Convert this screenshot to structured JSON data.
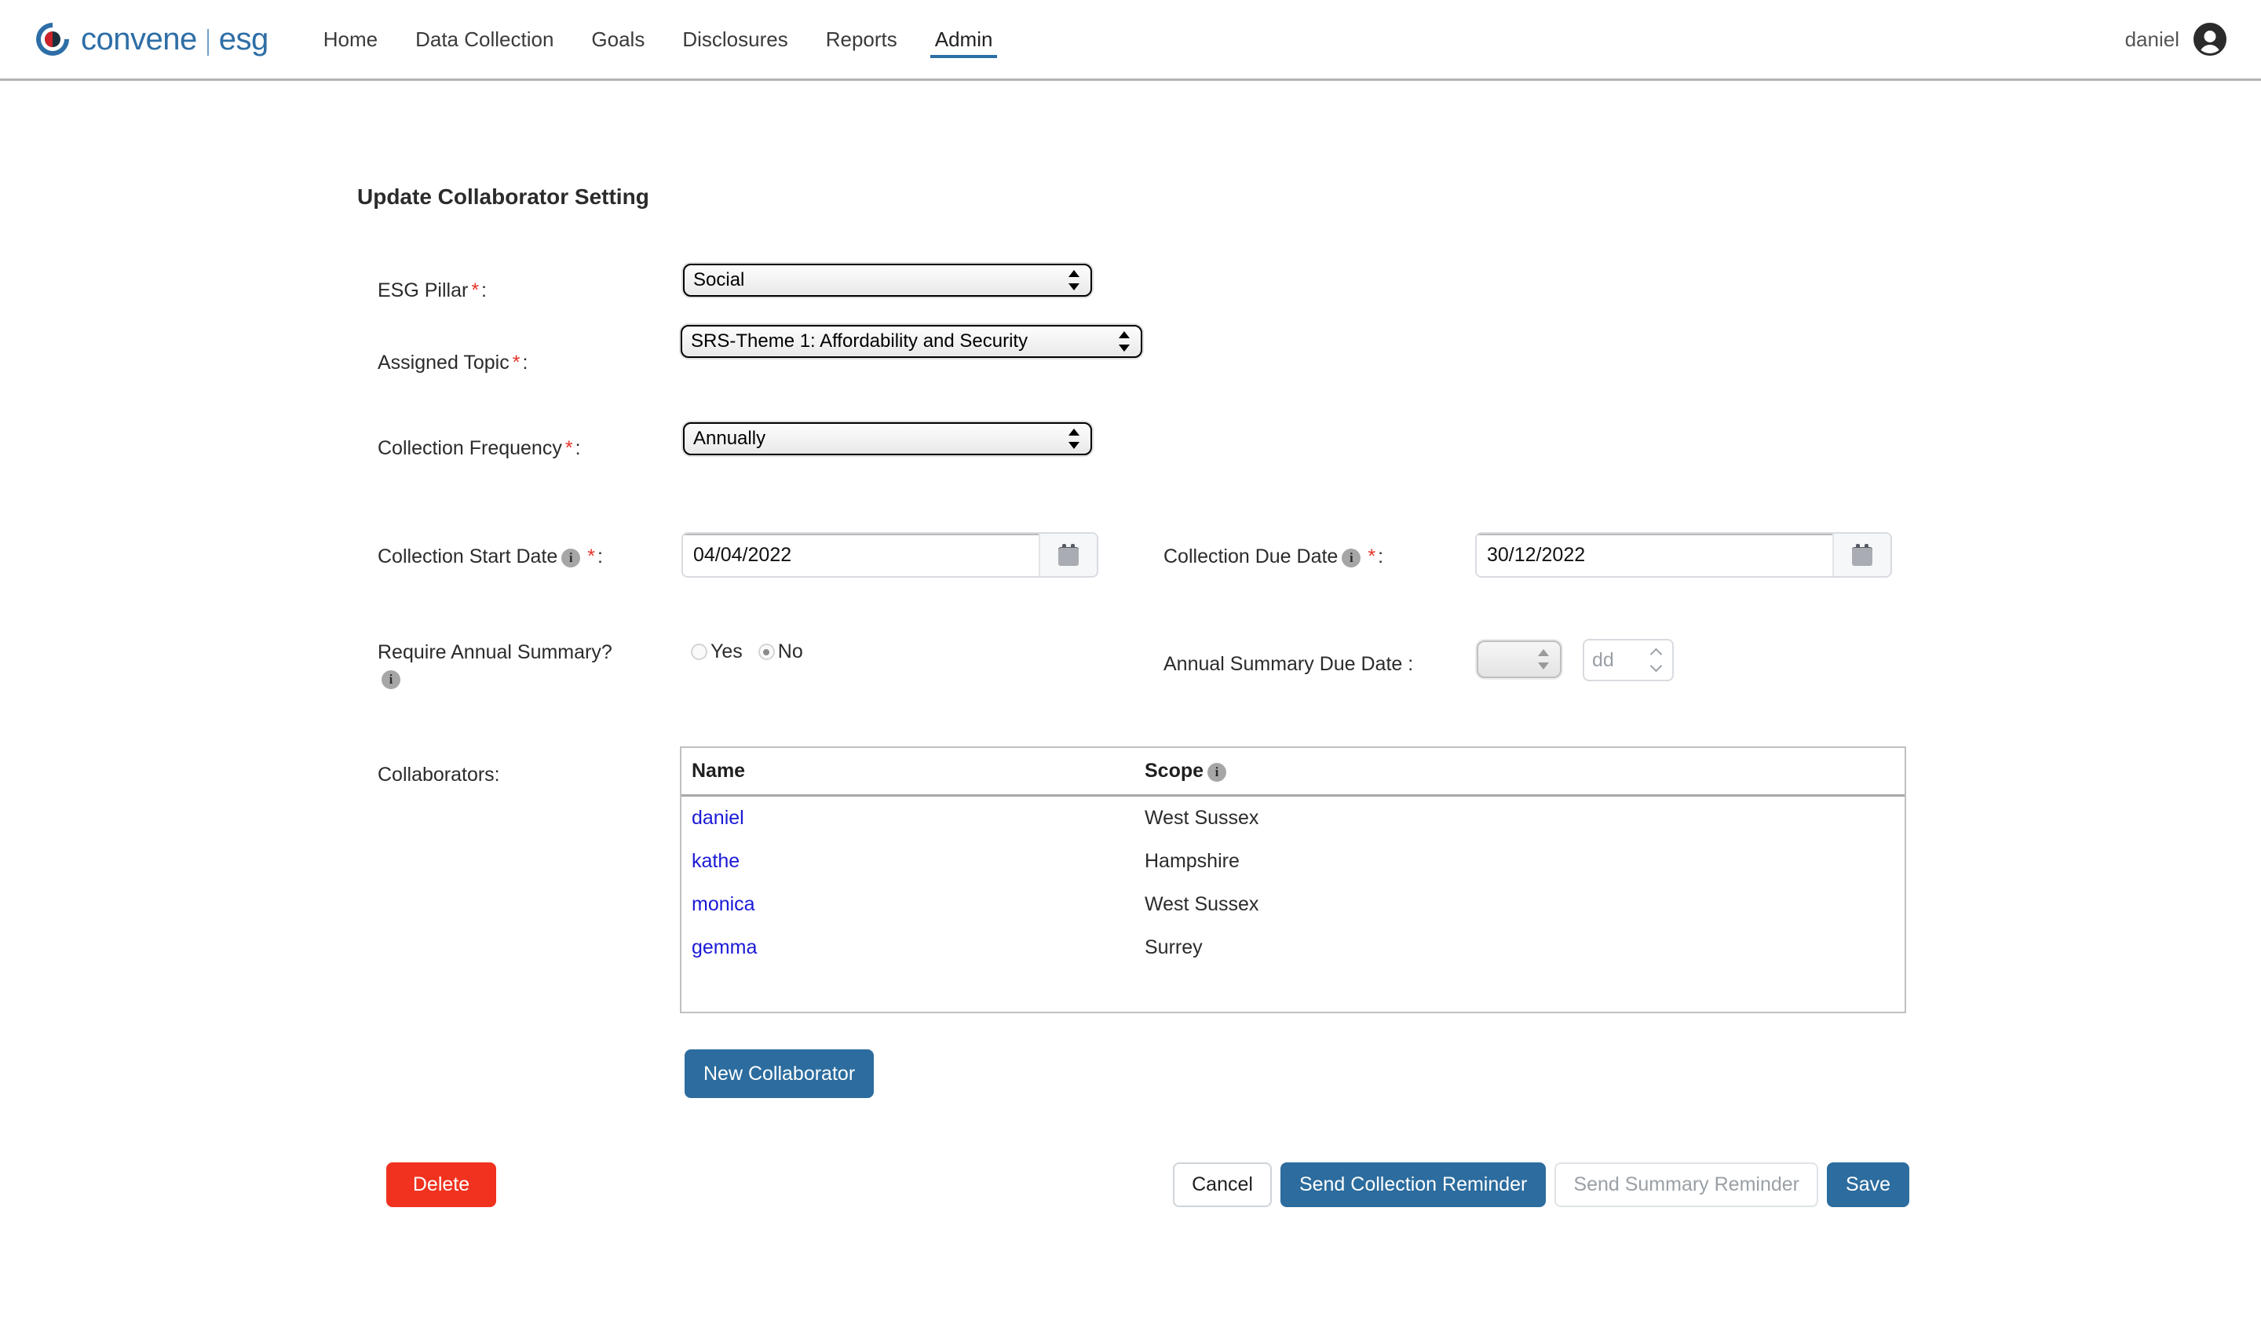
{
  "brand": {
    "name": "convene",
    "sub": "esg"
  },
  "nav": {
    "items": [
      {
        "label": "Home",
        "active": false
      },
      {
        "label": "Data Collection",
        "active": false
      },
      {
        "label": "Goals",
        "active": false
      },
      {
        "label": "Disclosures",
        "active": false
      },
      {
        "label": "Reports",
        "active": false
      },
      {
        "label": "Admin",
        "active": true
      }
    ]
  },
  "user": {
    "name": "daniel",
    "avatar_icon": "user-avatar-icon"
  },
  "page": {
    "title": "Update Collaborator Setting"
  },
  "form": {
    "esg_pillar": {
      "label": "ESG Pillar",
      "required_mark": "*",
      "colon": ":",
      "value": "Social"
    },
    "assigned_topic": {
      "label": "Assigned Topic",
      "required_mark": "*",
      "colon": ":",
      "value": "SRS-Theme 1: Affordability and Security"
    },
    "collection_frequency": {
      "label": "Collection Frequency",
      "required_mark": "*",
      "colon": ":",
      "value": "Annually"
    },
    "collection_start_date": {
      "label": "Collection Start Date",
      "required_mark": "*",
      "colon": ":",
      "value": "04/04/2022",
      "info_icon": "info-icon",
      "calendar_icon": "calendar-icon"
    },
    "collection_due_date": {
      "label": "Collection Due Date",
      "required_mark": "*",
      "colon": ":",
      "value": "30/12/2022",
      "info_icon": "info-icon",
      "calendar_icon": "calendar-icon"
    },
    "require_annual_summary": {
      "label": "Require Annual Summary?",
      "info_icon": "info-icon",
      "options": [
        {
          "label": "Yes",
          "selected": false
        },
        {
          "label": "No",
          "selected": true
        }
      ],
      "selected": "No"
    },
    "annual_summary_due_date": {
      "label": "Annual Summary Due Date :",
      "month_value": "",
      "day_placeholder": "dd",
      "disabled": true
    },
    "collaborators_label": "Collaborators:"
  },
  "table": {
    "columns": [
      {
        "key": "name",
        "label": "Name"
      },
      {
        "key": "scope",
        "label": "Scope",
        "info_icon": "info-icon"
      }
    ],
    "rows": [
      {
        "name": "daniel",
        "scope": "West Sussex"
      },
      {
        "name": "kathe",
        "scope": "Hampshire"
      },
      {
        "name": "monica",
        "scope": "West Sussex"
      },
      {
        "name": "gemma",
        "scope": "Surrey"
      }
    ]
  },
  "buttons": {
    "new_collaborator": "New Collaborator",
    "delete": "Delete",
    "cancel": "Cancel",
    "send_collection_reminder": "Send Collection Reminder",
    "send_summary_reminder": "Send Summary Reminder",
    "save": "Save"
  },
  "colors": {
    "brand_blue": "#2e6ea6",
    "brand_red": "#cc2229",
    "primary": "#2c6c9e",
    "danger": "#f0321f",
    "link": "#1a19d6",
    "required": "#e8342a"
  }
}
